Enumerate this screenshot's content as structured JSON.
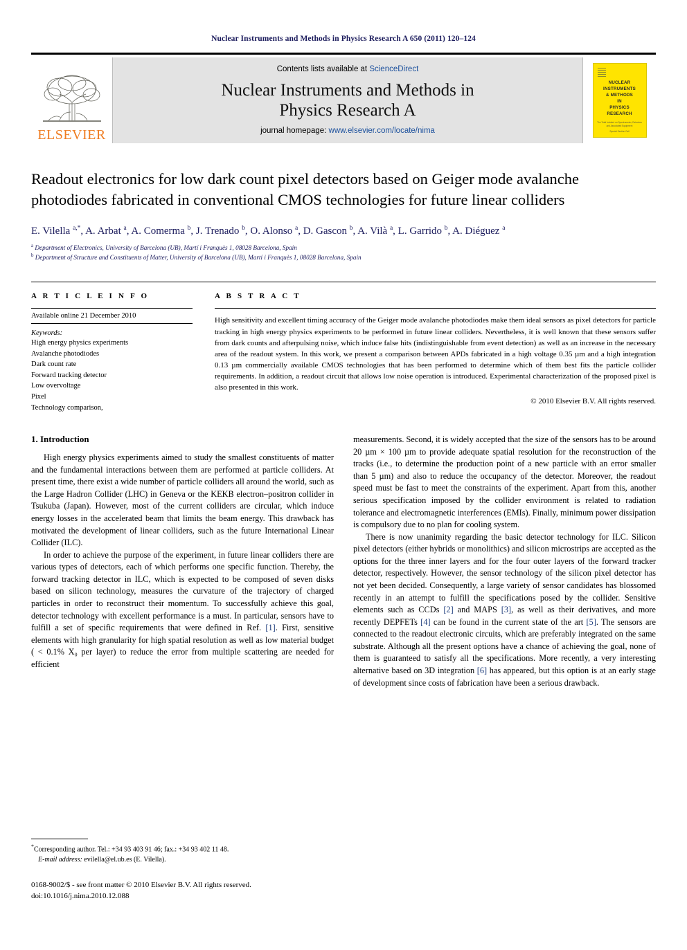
{
  "running_head": "Nuclear Instruments and Methods in Physics Research A 650 (2011) 120–124",
  "masthead": {
    "publisher_wordmark": "ELSEVIER",
    "contents_prefix": "Contents lists available at ",
    "contents_link": "ScienceDirect",
    "journal_title_line1": "Nuclear Instruments and Methods in",
    "journal_title_line2": "Physics Research A",
    "homepage_label": "journal homepage: ",
    "homepage_url": "www.elsevier.com/locate/nima",
    "cover": {
      "title_lines": [
        "NUCLEAR",
        "INSTRUMENTS",
        "& METHODS",
        "IN",
        "PHYSICS",
        "RESEARCH"
      ],
      "subtitle": "The Total Incident on Spectrometer, Detectors and Associated Equipment",
      "footer": "Special Section Call"
    }
  },
  "article": {
    "title": "Readout electronics for low dark count pixel detectors based on Geiger mode avalanche photodiodes fabricated in conventional CMOS technologies for future linear colliders",
    "authors_html": "E. Vilella <sup>a,*</sup>, A. Arbat <sup>a</sup>, A. Comerma <sup>b</sup>, J. Trenado <sup>b</sup>, O. Alonso <sup>a</sup>, D. Gascon <sup>b</sup>, A. Vilà <sup>a</sup>, L. Garrido <sup>b</sup>, A. Diéguez <sup>a</sup>",
    "affiliations": [
      {
        "marker": "a",
        "text": "Department of Electronics, University of Barcelona (UB), Martí i Franquès 1, 08028 Barcelona, Spain"
      },
      {
        "marker": "b",
        "text": "Department of Structure and Constituents of Matter, University of Barcelona (UB), Martí i Franquès 1, 08028 Barcelona, Spain"
      }
    ]
  },
  "article_info": {
    "heading": "A R T I C L E   I N F O",
    "history": "Available online 21 December 2010",
    "keywords_label": "Keywords:",
    "keywords": [
      "High energy physics experiments",
      "Avalanche photodiodes",
      "Dark count rate",
      "Forward tracking detector",
      "Low overvoltage",
      "Pixel",
      "Technology comparison,"
    ]
  },
  "abstract": {
    "heading": "A B S T R A C T",
    "text": "High sensitivity and excellent timing accuracy of the Geiger mode avalanche photodiodes make them ideal sensors as pixel detectors for particle tracking in high energy physics experiments to be performed in future linear colliders. Nevertheless, it is well known that these sensors suffer from dark counts and afterpulsing noise, which induce false hits (indistinguishable from event detection) as well as an increase in the necessary area of the readout system. In this work, we present a comparison between APDs fabricated in a high voltage 0.35 µm and a high integration 0.13 µm commercially available CMOS technologies that has been performed to determine which of them best fits the particle collider requirements. In addition, a readout circuit that allows low noise operation is introduced. Experimental characterization of the proposed pixel is also presented in this work.",
    "copyright": "© 2010 Elsevier B.V. All rights reserved."
  },
  "body": {
    "section_number_title": "1.  Introduction",
    "left_paragraphs": [
      "High energy physics experiments aimed to study the smallest constituents of matter and the fundamental interactions between them are performed at particle colliders. At present time, there exist a wide number of particle colliders all around the world, such as the Large Hadron Collider (LHC) in Geneva or the KEKB electron–positron collider in Tsukuba (Japan). However, most of the current colliders are circular, which induce energy losses in the accelerated beam that limits the beam energy. This drawback has motivated the development of linear colliders, such as the future International Linear Collider (ILC)."
    ],
    "left_para_2_part1": "In order to achieve the purpose of the experiment, in future linear colliders there are various types of detectors, each of which performs one specific function. Thereby, the forward tracking detector in ILC, which is expected to be composed of seven disks based on silicon technology, measures the curvature of the trajectory of charged particles in order to reconstruct their momentum. To successfully achieve this goal, detector technology with excellent performance is a must. In particular, sensors have to fulfill a set of specific requirements that were defined in Ref. ",
    "left_para_2_ref": "[1]",
    "left_para_2_part2": ". First, sensitive elements with high granularity for high spatial resolution as well as low material budget ( < 0.1% X₀ per layer) to reduce the error from multiple scattering are needed for efficient",
    "right_para_1": "measurements. Second, it is widely accepted that the size of the sensors has to be around 20 µm × 100 µm to provide adequate spatial resolution for the reconstruction of the tracks (i.e., to determine the production point of a new particle with an error smaller than 5 µm) and also to reduce the occupancy of the detector. Moreover, the readout speed must be fast to meet the constraints of the experiment. Apart from this, another serious specification imposed by the collider environment is related to radiation tolerance and electromagnetic interferences (EMIs). Finally, minimum power dissipation is compulsory due to no plan for cooling system.",
    "right_para_2_part1": "There is now unanimity regarding the basic detector technology for ILC. Silicon pixel detectors (either hybrids or monolithics) and silicon microstrips are accepted as the options for the three inner layers and for the four outer layers of the forward tracker detector, respectively. However, the sensor technology of the silicon pixel detector has not yet been decided. Consequently, a large variety of sensor candidates has blossomed recently in an attempt to fulfill the specifications posed by the collider. Sensitive elements such as CCDs ",
    "right_ref_2": "[2]",
    "right_para_2_part2": " and MAPS ",
    "right_ref_3": "[3]",
    "right_para_2_part3": ", as well as their derivatives, and more recently DEPFETs ",
    "right_ref_4": "[4]",
    "right_para_2_part4": " can be found in the current state of the art ",
    "right_ref_5": "[5]",
    "right_para_2_part5": ". The sensors are connected to the readout electronic circuits, which are preferably integrated on the same substrate. Although all the present options have a chance of achieving the goal, none of them is guaranteed to satisfy all the specifications. More recently, a very interesting alternative based on 3D integration ",
    "right_ref_6": "[6]",
    "right_para_2_part6": " has appeared, but this option is at an early stage of development since costs of fabrication have been a serious drawback."
  },
  "footnote": {
    "corresponding": "Corresponding author. Tel.: +34 93 403 91 46; fax.: +34 93 402 11 48.",
    "email_label": "E-mail address:",
    "email": "evilella@el.ub.es (E. Vilella)."
  },
  "footer": {
    "issn_line": "0168-9002/$ - see front matter © 2010 Elsevier B.V. All rights reserved.",
    "doi_line": "doi:10.1016/j.nima.2010.12.088"
  }
}
